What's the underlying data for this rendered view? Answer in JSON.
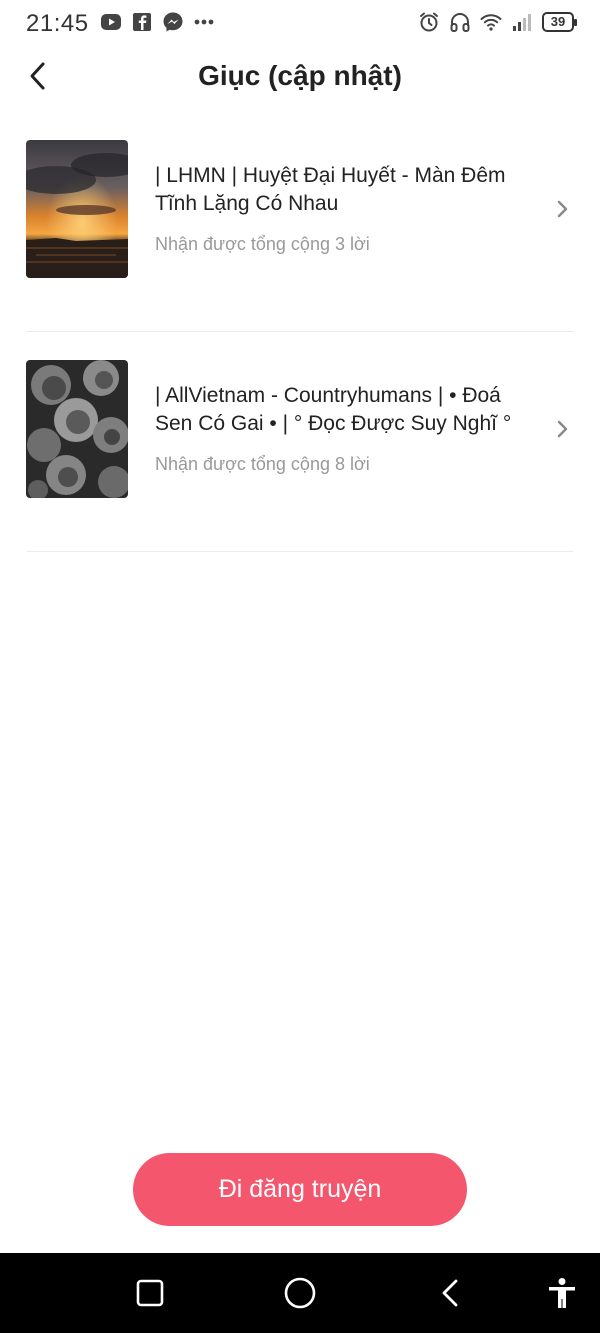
{
  "status_bar": {
    "time": "21:45",
    "left_icons": [
      "video-app-icon",
      "facebook-icon",
      "messenger-icon",
      "more-dots-icon"
    ],
    "right_icons": [
      "alarm-icon",
      "headphones-icon",
      "wifi-icon",
      "signal-icon"
    ],
    "battery": "39"
  },
  "header": {
    "title": "Giục (cập nhật)",
    "back_icon": "chevron-left-icon"
  },
  "stories": [
    {
      "title": "| LHMN | Huyệt Đại Huyết - Màn Đêm Tĩnh Lặng Có Nhau",
      "subtitle": "Nhận được tổng cộng 3 lời",
      "cover": "sunset-cover"
    },
    {
      "title": "| AllVietnam - Countryhumans | • Đoá Sen Có Gai • | ° Đọc Được Suy Nghĩ °",
      "subtitle": "Nhận được tổng cộng 8 lời",
      "cover": "lotus-bw-cover"
    }
  ],
  "cta": {
    "label": "Đi đăng truyện",
    "color": "#f4566e"
  },
  "nav_bar": {
    "buttons": [
      "recents-square-icon",
      "home-circle-icon",
      "back-triangle-icon",
      "accessibility-icon"
    ]
  }
}
